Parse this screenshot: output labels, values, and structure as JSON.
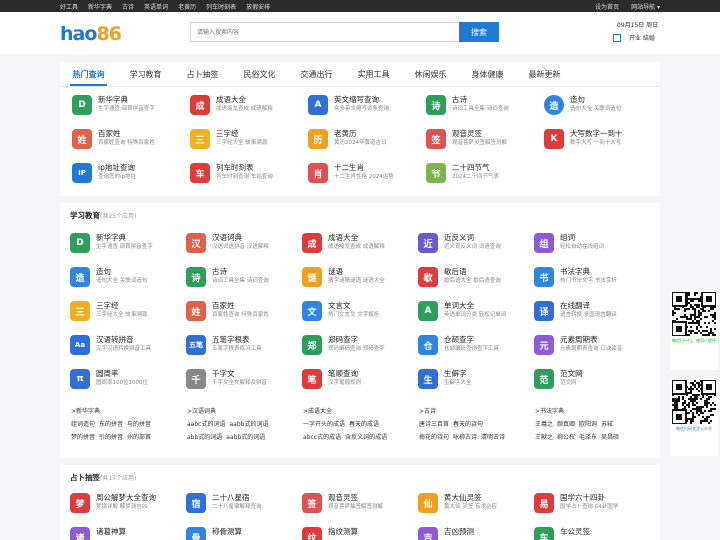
{
  "topbar": {
    "left": [
      "好工具",
      "新华字典",
      "古诗",
      "英语单词",
      "老黄历",
      "列车时刻表",
      "放假安排"
    ],
    "right": [
      "设为首页",
      "网站导航 ▾"
    ]
  },
  "header": {
    "logo_a": "hao",
    "logo_b": "86",
    "search_placeholder": "请输入搜索内容",
    "search_button": "搜索",
    "date": "09月15日 周日",
    "calendar": "开业 结婚"
  },
  "tabs": [
    "热门查询",
    "学习教育",
    "占卜抽签",
    "民俗文化",
    "交通出行",
    "实用工具",
    "休闲娱乐",
    "身体健康",
    "最新更新"
  ],
  "hot": [
    {
      "t": "新华字典",
      "d": "生字速查 部首拼音查字",
      "c": "#2e9e5b",
      "i": "D"
    },
    {
      "t": "成语大全",
      "d": "成语接龙查成 成语解释",
      "c": "#e03a3a",
      "i": "成"
    },
    {
      "t": "英文缩写查询",
      "d": "众多英文缩写词条查询",
      "c": "#2f6fd6",
      "i": "A"
    },
    {
      "t": "古诗",
      "d": "诗词工具全集 诗词查询",
      "c": "#2e9e5b",
      "i": "诗"
    },
    {
      "t": "造句",
      "d": "造句大全 关联词造句",
      "c": "#2f86e0",
      "i": "造"
    },
    {
      "t": "百家姓",
      "d": "百家姓查询 特殊百家姓",
      "c": "#e0604a",
      "i": "姓"
    },
    {
      "t": "三字经",
      "d": "三字经大全 故事溯源",
      "c": "#f0b020",
      "i": "三"
    },
    {
      "t": "老黄历",
      "d": "黄历2024年黄道吉日",
      "c": "#f0a020",
      "i": "历"
    },
    {
      "t": "观音灵签",
      "d": "观音菩萨灵签解签测解",
      "c": "#e05050",
      "i": "签"
    },
    {
      "t": "大写数字一到十",
      "d": "数字大写 一到十大写",
      "c": "#e03a3a",
      "i": "K"
    },
    {
      "t": "ip地址查询",
      "d": "查询您的ip地址",
      "c": "#1f7ad6",
      "i": "IP"
    },
    {
      "t": "列车时刻表",
      "d": "列车时刻查询 车站查询",
      "c": "#e03a3a",
      "i": "车"
    },
    {
      "t": "十二生肖",
      "d": "十二生肖性格 2024运势",
      "c": "#e05050",
      "i": "肖"
    },
    {
      "t": "二十四节气",
      "d": "2024二十四节气表",
      "c": "#7ab648",
      "i": "节"
    }
  ],
  "learn": {
    "title": "学习教育",
    "count": "(共25个应用)",
    "items": [
      {
        "t": "新华字典",
        "d": "生字速查 部首拼音查字",
        "c": "#2e9e5b",
        "i": "D"
      },
      {
        "t": "汉语词典",
        "d": "汉语词语拼音 汉语解释",
        "c": "#e0604a",
        "i": "汉"
      },
      {
        "t": "成语大全",
        "d": "成语接龙查成 成语解释",
        "c": "#e03a3a",
        "i": "成"
      },
      {
        "t": "近反义词",
        "d": "近义词反义词 词语查询",
        "c": "#6a5acd",
        "i": "近"
      },
      {
        "t": "组词",
        "d": "轻松自动在线组词",
        "c": "#8e5ad6",
        "i": "组"
      },
      {
        "t": "造句",
        "d": "造句大全 关联词造句",
        "c": "#2f86e0",
        "i": "造"
      },
      {
        "t": "古诗",
        "d": "诗词工具全集 诗词查询",
        "c": "#2e9e5b",
        "i": "诗"
      },
      {
        "t": "谜语",
        "d": "猜字谜猜谜语 谜语大全",
        "c": "#f0a020",
        "i": "谜"
      },
      {
        "t": "歇后语",
        "d": "歇后语大全 歇后语查询",
        "c": "#e03a3a",
        "i": "歇"
      },
      {
        "t": "书法字典",
        "d": "热门书法文字 书法赏析",
        "c": "#2f86e0",
        "i": "书"
      },
      {
        "t": "三字经",
        "d": "三字经大全 故事溯源",
        "c": "#f0b020",
        "i": "三"
      },
      {
        "t": "百家姓",
        "d": "百家姓查询 特殊百家姓",
        "c": "#e0604a",
        "i": "姓"
      },
      {
        "t": "文言文",
        "d": "热门文言文 文字解析",
        "c": "#2f86e0",
        "i": "文"
      },
      {
        "t": "单词大全",
        "d": "英语单词分类 轻松记单词",
        "c": "#2e9e5b",
        "i": "A"
      },
      {
        "t": "在线翻译",
        "d": "语言转换 多国语言翻译",
        "c": "#2f6fd6",
        "i": "译"
      },
      {
        "t": "汉语转拼音",
        "d": "汉字汉语转换拼音工具",
        "c": "#2f6fd6",
        "i": "Aa"
      },
      {
        "t": "五笔字根表",
        "d": "五笔字根表练习工具",
        "c": "#2f6fd6",
        "i": "五笔"
      },
      {
        "t": "郑码查字",
        "d": "郑码编码查询 郑码查字",
        "c": "#2e9e5b",
        "i": "郑"
      },
      {
        "t": "仓颉查字",
        "d": "仓颉编码查询查字工具",
        "c": "#2f86e0",
        "i": "仓"
      },
      {
        "t": "元素周期表",
        "d": "元素周期表查询 口诀读音",
        "c": "#8e5ad6",
        "i": "元"
      },
      {
        "t": "圆周率",
        "d": "圆周率100位1000位",
        "c": "#2f6fd6",
        "i": "π"
      },
      {
        "t": "千字文",
        "d": "千字文全文解释及拼音",
        "c": "#888888",
        "i": "千"
      },
      {
        "t": "笔顺查询",
        "d": "汉字笔顺规则",
        "c": "#e03a3a",
        "i": "笔"
      },
      {
        "t": "生僻字",
        "d": "生僻字大全",
        "c": "#2f6fd6",
        "i": "生"
      },
      {
        "t": "范文网",
        "d": "范文网",
        "c": "#2e9e5b",
        "i": "范"
      }
    ],
    "lists": [
      {
        "hd": ">新华字典",
        "rows": [
          [
            "组词造句",
            "东的拼音",
            "与的拼音"
          ],
          [
            "梦的拼音",
            "引的拼音",
            "州的部首"
          ]
        ]
      },
      {
        "hd": ">汉语词典",
        "rows": [
          [
            "aabc式的词语",
            "aabb式的词语"
          ],
          [
            "abb式的词语",
            "aabb式的词语"
          ]
        ]
      },
      {
        "hd": ">成语大全",
        "rows": [
          [
            "一字开头的成语",
            "春天的成语"
          ],
          [
            "abcc式的成语",
            "含反义词的成语"
          ]
        ]
      },
      {
        "hd": ">古诗",
        "rows": [
          [
            "唐诗三百首",
            "春天的诗句"
          ],
          [
            "梅花的诗句",
            "咏柳古诗",
            "清明古诗"
          ]
        ]
      },
      {
        "hd": ">书法字典",
        "rows": [
          [
            "王羲之",
            "颜真卿",
            "欧阳询",
            "苏轼"
          ],
          [
            "王献之",
            "柳公权",
            "毛泽东",
            "吴昌硕"
          ]
        ]
      }
    ]
  },
  "divine": {
    "title": "占卜抽签",
    "count": "(共17个应用)",
    "items": [
      {
        "t": "周公解梦大全查询",
        "d": "梦境详解 解梦测吉凶",
        "c": "#e03a3a",
        "i": "梦"
      },
      {
        "t": "二十八星宿",
        "d": "二十八星宿解释查询",
        "c": "#2f6fd6",
        "i": "宿"
      },
      {
        "t": "观音灵签",
        "d": "观音菩萨抽签解签测解",
        "c": "#e05050",
        "i": "签"
      },
      {
        "t": "黄大仙灵签",
        "d": "黄大仙 灵签 有求必应",
        "c": "#f0a020",
        "i": "仙"
      },
      {
        "t": "国学六十四卦",
        "d": "国学占卜查询 64卦国学",
        "c": "#e03a3a",
        "i": "易"
      },
      {
        "t": "诸葛神算",
        "d": "",
        "c": "#8e5ad6",
        "i": "诸"
      },
      {
        "t": "称骨测算",
        "d": "",
        "c": "#2f86e0",
        "i": "骨"
      },
      {
        "t": "指纹测算",
        "d": "",
        "c": "#e03a3a",
        "i": "纹"
      },
      {
        "t": "吉凶预测",
        "d": "",
        "c": "#8e5ad6",
        "i": "吉"
      },
      {
        "t": "车公灵签",
        "d": "",
        "c": "#2e9e5b",
        "i": "车"
      }
    ]
  },
  "qr": {
    "cap1": "微信扫一扫，使用小程序",
    "cap2": "微信扫码关注公众号",
    "brand": "hao86"
  }
}
